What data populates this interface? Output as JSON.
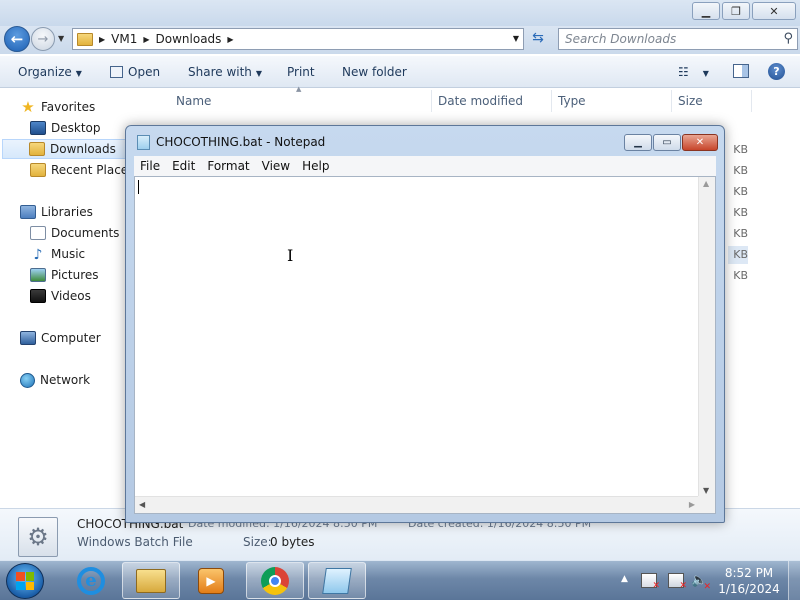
{
  "explorer": {
    "breadcrumb": [
      "VM1",
      "Downloads"
    ],
    "search_placeholder": "Search Downloads",
    "toolbar": {
      "organize": "Organize",
      "open": "Open",
      "share_with": "Share with",
      "print": "Print",
      "new_folder": "New folder"
    },
    "columns": [
      "Name",
      "Date modified",
      "Type",
      "Size"
    ],
    "size_fragments": [
      "KB",
      "KB",
      "KB",
      "KB",
      "KB",
      "KB",
      "KB"
    ],
    "sidebar": {
      "favorites": "Favorites",
      "desktop": "Desktop",
      "downloads": "Downloads",
      "recent": "Recent Places",
      "libraries": "Libraries",
      "documents": "Documents",
      "music": "Music",
      "pictures": "Pictures",
      "videos": "Videos",
      "computer": "Computer",
      "network": "Network"
    },
    "details": {
      "name": "CHOCOTHING.bat",
      "modified": "Date modified: 1/16/2024 8:50 PM",
      "created": "Date created: 1/16/2024 8:50 PM",
      "type": "Windows Batch File",
      "size_label": "Size:",
      "size_value": "0 bytes"
    }
  },
  "notepad": {
    "title": "CHOCOTHING.bat - Notepad",
    "menu": [
      "File",
      "Edit",
      "Format",
      "View",
      "Help"
    ],
    "content": ""
  },
  "taskbar": {
    "time": "8:52 PM",
    "date": "1/16/2024"
  }
}
